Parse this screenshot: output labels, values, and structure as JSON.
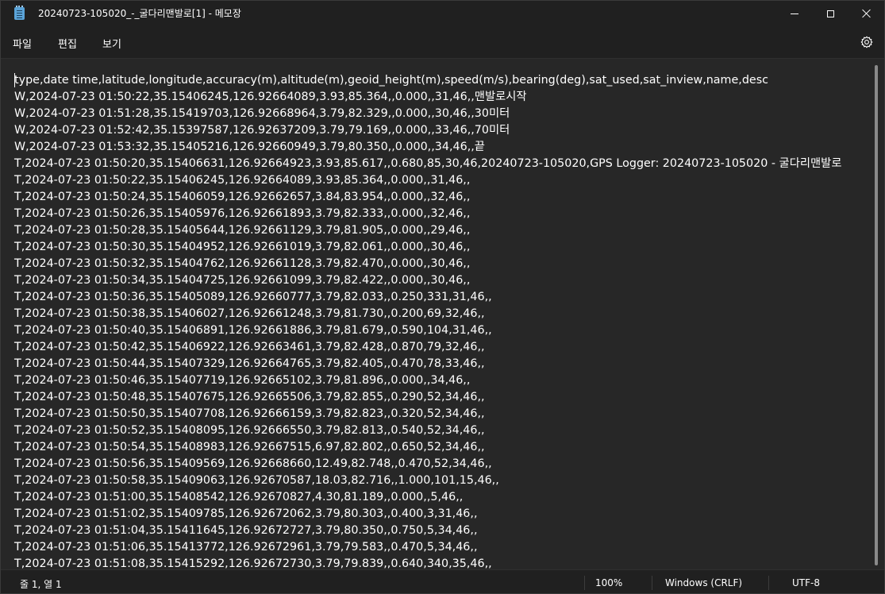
{
  "window": {
    "title": "20240723-105020_-_굴다리맨발로[1] - 메모장",
    "icon": "notepad-icon",
    "controls": [
      "minimize-icon",
      "maximize-icon",
      "close-icon"
    ]
  },
  "menu": {
    "file": "파일",
    "edit": "편집",
    "view": "보기",
    "settings_icon": "gear-icon"
  },
  "editor": {
    "lines": [
      "type,date time,latitude,longitude,accuracy(m),altitude(m),geoid_height(m),speed(m/s),bearing(deg),sat_used,sat_inview,name,desc",
      "W,2024-07-23 01:50:22,35.15406245,126.92664089,3.93,85.364,,0.000,,31,46,,맨발로시작",
      "W,2024-07-23 01:51:28,35.15419703,126.92668964,3.79,82.329,,0.000,,30,46,,30미터",
      "W,2024-07-23 01:52:42,35.15397587,126.92637209,3.79,79.169,,0.000,,33,46,,70미터",
      "W,2024-07-23 01:53:32,35.15405216,126.92660949,3.79,80.350,,0.000,,34,46,,끝",
      "T,2024-07-23 01:50:20,35.15406631,126.92664923,3.93,85.617,,0.680,85,30,46,20240723-105020,GPS Logger: 20240723-105020 - 굴다리맨발로",
      "T,2024-07-23 01:50:22,35.15406245,126.92664089,3.93,85.364,,0.000,,31,46,,",
      "T,2024-07-23 01:50:24,35.15406059,126.92662657,3.84,83.954,,0.000,,32,46,,",
      "T,2024-07-23 01:50:26,35.15405976,126.92661893,3.79,82.333,,0.000,,32,46,,",
      "T,2024-07-23 01:50:28,35.15405644,126.92661129,3.79,81.905,,0.000,,29,46,,",
      "T,2024-07-23 01:50:30,35.15404952,126.92661019,3.79,82.061,,0.000,,30,46,,",
      "T,2024-07-23 01:50:32,35.15404762,126.92661128,3.79,82.470,,0.000,,30,46,,",
      "T,2024-07-23 01:50:34,35.15404725,126.92661099,3.79,82.422,,0.000,,30,46,,",
      "T,2024-07-23 01:50:36,35.15405089,126.92660777,3.79,82.033,,0.250,331,31,46,,",
      "T,2024-07-23 01:50:38,35.15406027,126.92661248,3.79,81.730,,0.200,69,32,46,,",
      "T,2024-07-23 01:50:40,35.15406891,126.92661886,3.79,81.679,,0.590,104,31,46,,",
      "T,2024-07-23 01:50:42,35.15406922,126.92663461,3.79,82.428,,0.870,79,32,46,,",
      "T,2024-07-23 01:50:44,35.15407329,126.92664765,3.79,82.405,,0.470,78,33,46,,",
      "T,2024-07-23 01:50:46,35.15407719,126.92665102,3.79,81.896,,0.000,,34,46,,",
      "T,2024-07-23 01:50:48,35.15407675,126.92665506,3.79,82.855,,0.290,52,34,46,,",
      "T,2024-07-23 01:50:50,35.15407708,126.92666159,3.79,82.823,,0.320,52,34,46,,",
      "T,2024-07-23 01:50:52,35.15408095,126.92666550,3.79,82.813,,0.540,52,34,46,,",
      "T,2024-07-23 01:50:54,35.15408983,126.92667515,6.97,82.802,,0.650,52,34,46,,",
      "T,2024-07-23 01:50:56,35.15409569,126.92668660,12.49,82.748,,0.470,52,34,46,,",
      "T,2024-07-23 01:50:58,35.15409063,126.92670587,18.03,82.716,,1.000,101,15,46,,",
      "T,2024-07-23 01:51:00,35.15408542,126.92670827,4.30,81.189,,0.000,,5,46,,",
      "T,2024-07-23 01:51:02,35.15409785,126.92672062,3.79,80.303,,0.400,3,31,46,,",
      "T,2024-07-23 01:51:04,35.15411645,126.92672727,3.79,80.350,,0.750,5,34,46,,",
      "T,2024-07-23 01:51:06,35.15413772,126.92672961,3.79,79.583,,0.470,5,34,46,,",
      "T,2024-07-23 01:51:08,35.15415292,126.92672730,3.79,79.839,,0.640,340,35,46,,"
    ]
  },
  "status": {
    "position": "줄 1, 열 1",
    "zoom": "100%",
    "line_ending": "Windows (CRLF)",
    "encoding": "UTF-8"
  }
}
